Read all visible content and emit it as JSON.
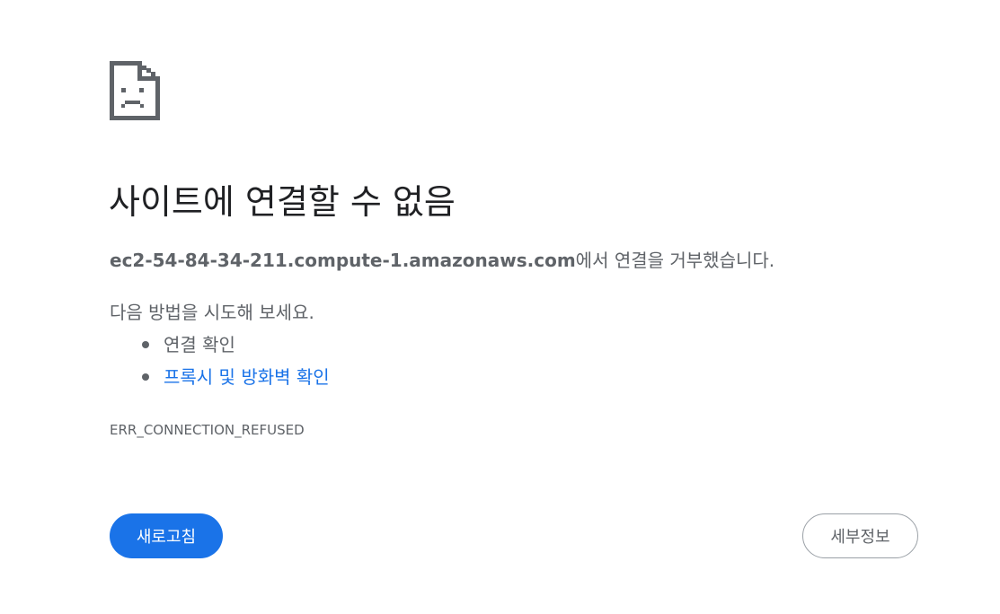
{
  "icon": "sad-document-icon",
  "title": "사이트에 연결할 수 없음",
  "summary": {
    "host": "ec2-54-84-34-211.compute-1.amazonaws.com",
    "message": "에서 연결을 거부했습니다."
  },
  "suggestions": {
    "heading": "다음 방법을 시도해 보세요.",
    "items": [
      {
        "label": "연결 확인"
      },
      {
        "label": "프록시 및 방화벽 확인"
      }
    ]
  },
  "error_code": "ERR_CONNECTION_REFUSED",
  "buttons": {
    "reload": "새로고침",
    "details": "세부정보"
  },
  "colors": {
    "accent": "#1a73e8",
    "text": "#5f6368",
    "title": "#202124"
  }
}
